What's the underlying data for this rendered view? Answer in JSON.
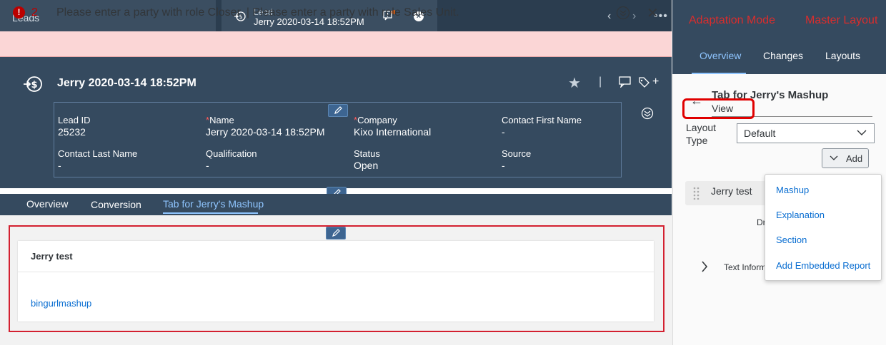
{
  "tabs": {
    "leads_label": "Leads",
    "lead_sub": "Lead",
    "lead_title": "Jerry 2020-03-14 18:52PM"
  },
  "nav": {
    "prev": "‹",
    "next": "›",
    "more": "•••"
  },
  "error": {
    "count": "2",
    "message": "Please enter a party with role Closer. | Please enter a party with role Sales Unit.",
    "close": "✕"
  },
  "header": {
    "title": "Jerry 2020-03-14 18:52PM",
    "fields": {
      "lead_id_label": "Lead ID",
      "lead_id_value": "25232",
      "name_label": "Name",
      "name_value": "Jerry 2020-03-14 18:52PM",
      "company_label": "Company",
      "company_value": "Kixo International",
      "contact_first_label": "Contact First Name",
      "contact_first_value": "-",
      "contact_last_label": "Contact Last Name",
      "contact_last_value": "-",
      "qualification_label": "Qualification",
      "qualification_value": "-",
      "status_label": "Status",
      "status_value": "Open",
      "source_label": "Source",
      "source_value": "-"
    },
    "required_mark": "*",
    "separator": "|",
    "plus": "+",
    "star": "★"
  },
  "section_tabs": [
    "Overview",
    "Conversion",
    "Tab for Jerry's Mashup"
  ],
  "card": {
    "title": "Jerry test",
    "link": "bingurlmashup"
  },
  "panel": {
    "mode": "Adaptation Mode",
    "master": "Master Layout",
    "tabs": [
      "Overview",
      "Changes",
      "Layouts"
    ],
    "back": "←",
    "title": "Tab for Jerry's Mashup",
    "view": "View",
    "layout_type_label": "Layout Type",
    "layout_type_value": "Default",
    "add_label": "Add",
    "item_label": "Jerry test",
    "dr_text": "Dr",
    "text_info": "Text Inform",
    "menu": [
      "Mashup",
      "Explanation",
      "Section",
      "Add Embedded Report"
    ]
  }
}
